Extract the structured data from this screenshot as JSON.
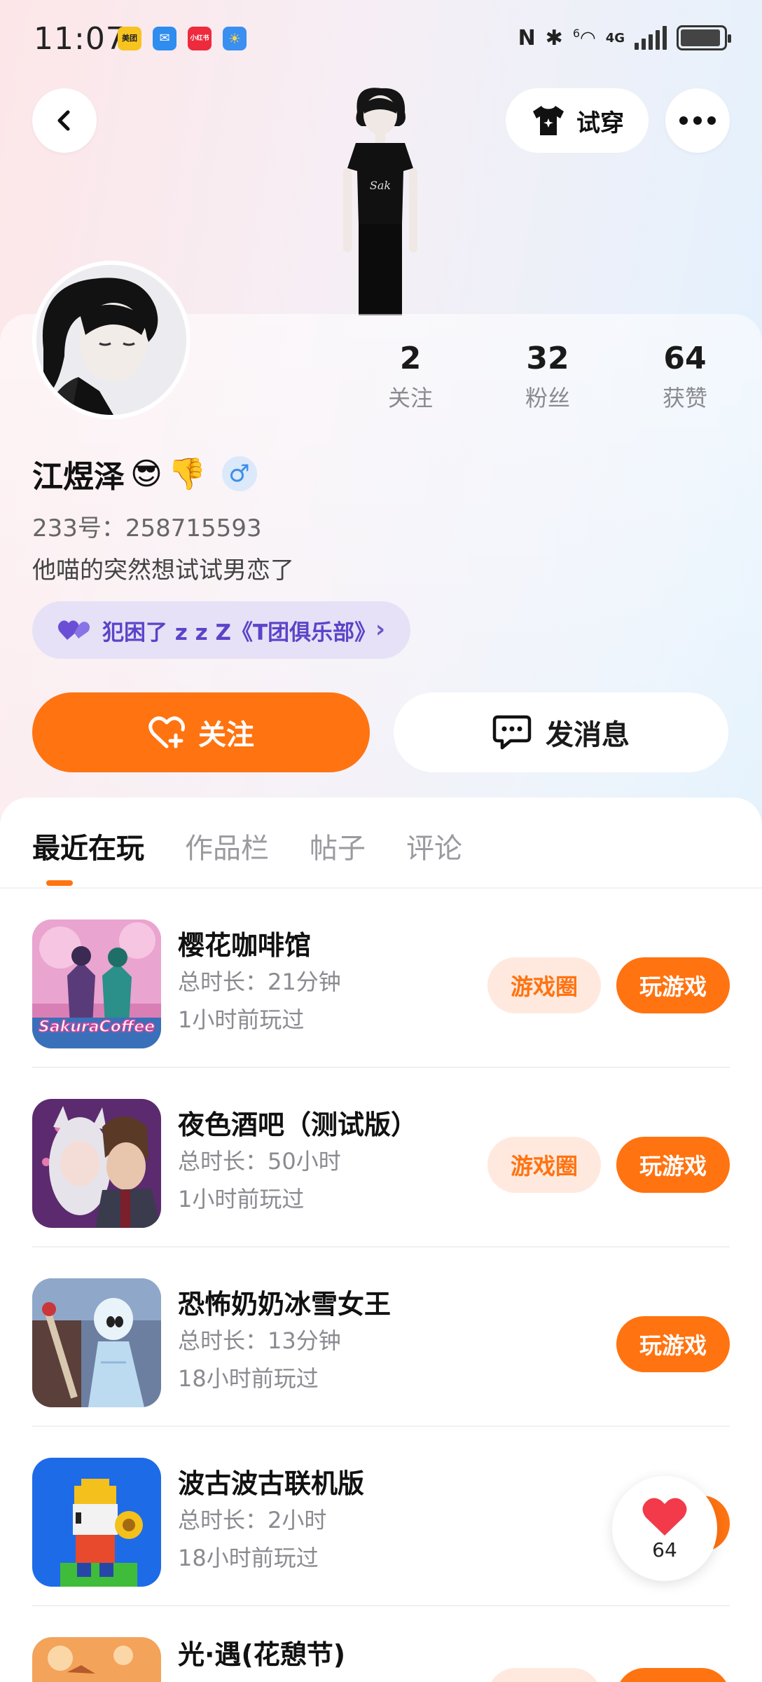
{
  "status_bar": {
    "time": "11:07",
    "app_badges": [
      {
        "label": "美团",
        "color": "#f7c41f"
      },
      {
        "label": "✉",
        "color": "#2f8df0"
      },
      {
        "label": "小红书",
        "color": "#ee2a3d"
      },
      {
        "label": "☀",
        "color": "#3a8ff0"
      }
    ],
    "network_label": "4G",
    "wifi_label": "6"
  },
  "header": {
    "try_on_label": "试穿"
  },
  "profile": {
    "stats": [
      {
        "value": "2",
        "label": "关注"
      },
      {
        "value": "32",
        "label": "粉丝"
      },
      {
        "value": "64",
        "label": "获赞"
      }
    ],
    "name": "江煜泽",
    "name_emojis": [
      "😎",
      "👎"
    ],
    "gender_symbol": "♂",
    "uid": "233号：258715593",
    "bio": "他喵的突然想试试男恋了",
    "club_chip": {
      "text": "犯困了 z z Z《T团俱乐部》",
      "heart_color": "#6a4fd6"
    },
    "follow_label": "关注",
    "message_label": "发消息"
  },
  "tabs": [
    {
      "label": "最近在玩",
      "active": true
    },
    {
      "label": "作品栏",
      "active": false
    },
    {
      "label": "帖子",
      "active": false
    },
    {
      "label": "评论",
      "active": false
    }
  ],
  "games": [
    {
      "title": "樱花咖啡馆",
      "duration": "总时长：21分钟",
      "last_played": "1小时前玩过",
      "circle_label": "游戏圈",
      "play_label": "玩游戏",
      "icon_text": "SakuraCoffee"
    },
    {
      "title": "夜色酒吧（测试版）",
      "duration": "总时长：50小时",
      "last_played": "1小时前玩过",
      "circle_label": "游戏圈",
      "play_label": "玩游戏"
    },
    {
      "title": "恐怖奶奶冰雪女王",
      "duration": "总时长：13分钟",
      "last_played": "18小时前玩过",
      "play_label": "玩游戏"
    },
    {
      "title": "波古波古联机版",
      "duration": "总时长：2小时",
      "last_played": "18小时前玩过"
    },
    {
      "title": "光·遇(花憩节)"
    }
  ],
  "floating_like": {
    "count": "64",
    "color": "#f23a4a"
  },
  "colors": {
    "accent": "#ff7311",
    "chip_bg": "#e6e1f6",
    "chip_text": "#5b44c8"
  }
}
